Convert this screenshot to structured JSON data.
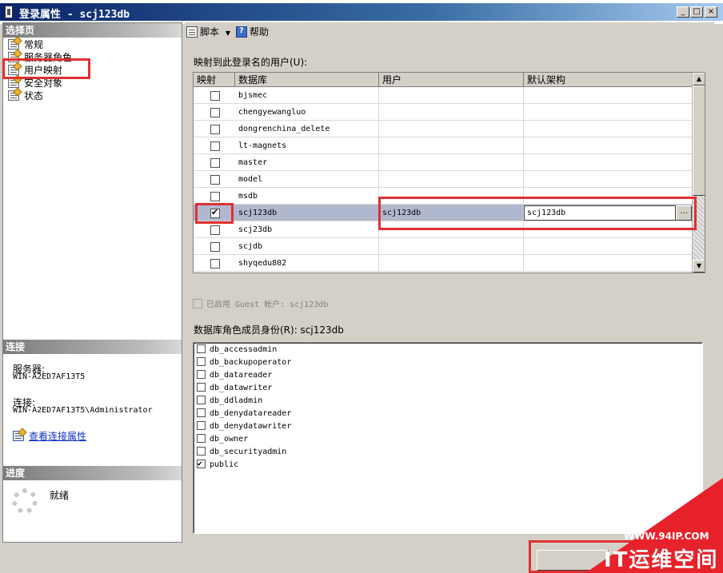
{
  "window": {
    "title": "登录属性 - scj123db",
    "minimize": "_",
    "maximize": "□",
    "close": "×"
  },
  "left": {
    "select_page_header": "选择页",
    "pages": [
      {
        "label": "常规"
      },
      {
        "label": "服务器角色"
      },
      {
        "label": "用户映射"
      },
      {
        "label": "安全对象"
      },
      {
        "label": "状态"
      }
    ],
    "connection_header": "连接",
    "server_label": "服务器:",
    "server_value": "WIN-A2ED7AF13T5",
    "connection_label": "连接:",
    "connection_value": "WIN-A2ED7AF13T5\\Administrator",
    "view_connection_link": "查看连接属性",
    "progress_header": "进度",
    "progress_status": "就绪"
  },
  "toolbar": {
    "script_label": "脚本",
    "help_label": "帮助"
  },
  "mapping": {
    "label": "映射到此登录名的用户(U):",
    "columns": [
      "映射",
      "数据库",
      "用户",
      "默认架构"
    ],
    "rows": [
      {
        "db": "bjsmec",
        "user": "",
        "schema": "",
        "mapped": false
      },
      {
        "db": "chengyewangluo",
        "user": "",
        "schema": "",
        "mapped": false
      },
      {
        "db": "dongrenchina_delete",
        "user": "",
        "schema": "",
        "mapped": false
      },
      {
        "db": "lt-magnets",
        "user": "",
        "schema": "",
        "mapped": false
      },
      {
        "db": "master",
        "user": "",
        "schema": "",
        "mapped": false
      },
      {
        "db": "model",
        "user": "",
        "schema": "",
        "mapped": false
      },
      {
        "db": "msdb",
        "user": "",
        "schema": "",
        "mapped": false
      },
      {
        "db": "scj123db",
        "user": "scj123db",
        "schema": "scj123db",
        "mapped": true
      },
      {
        "db": "scj23db",
        "user": "",
        "schema": "",
        "mapped": false
      },
      {
        "db": "scjdb",
        "user": "",
        "schema": "",
        "mapped": false
      },
      {
        "db": "shyqedu802",
        "user": "",
        "schema": "",
        "mapped": false
      }
    ],
    "ellipsis": "..."
  },
  "guest": {
    "label": "已启用 Guest 帐户: scj123db"
  },
  "roles": {
    "label": "数据库角色成员身份(R): scj123db",
    "items": [
      {
        "name": "db_accessadmin",
        "checked": false
      },
      {
        "name": "db_backupoperator",
        "checked": false
      },
      {
        "name": "db_datareader",
        "checked": false
      },
      {
        "name": "db_datawriter",
        "checked": false
      },
      {
        "name": "db_ddladmin",
        "checked": false
      },
      {
        "name": "db_denydatareader",
        "checked": false
      },
      {
        "name": "db_denydatawriter",
        "checked": false
      },
      {
        "name": "db_owner",
        "checked": false
      },
      {
        "name": "db_securityadmin",
        "checked": false
      },
      {
        "name": "public",
        "checked": true
      }
    ]
  },
  "watermark": {
    "url": "WWW.94IP.COM",
    "name": "IT运维空间"
  },
  "colors": {
    "highlight_red": "#e03030",
    "selected_row": "#b0b8d0",
    "titlebar": "#0a246a"
  }
}
